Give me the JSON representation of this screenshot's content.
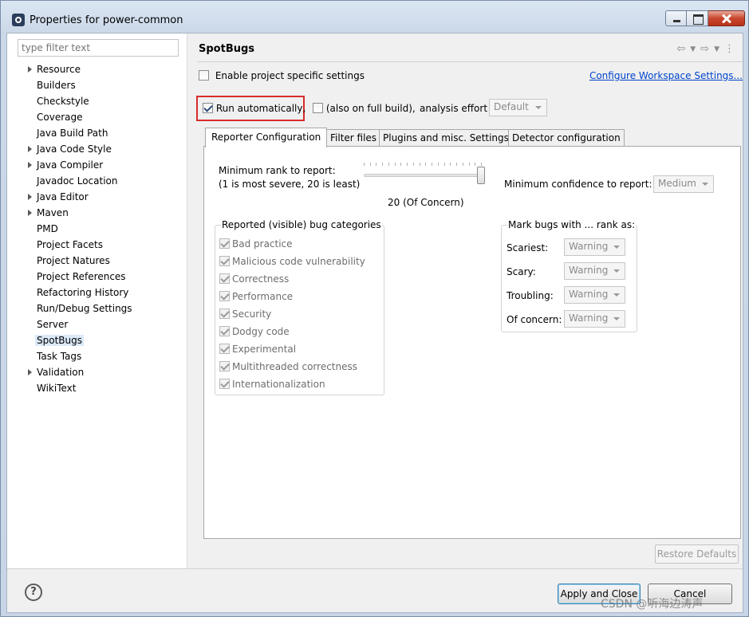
{
  "window": {
    "title": "Properties for power-common"
  },
  "filter": {
    "placeholder": "type filter text"
  },
  "tree": {
    "items": [
      {
        "label": "Resource",
        "expandable": true
      },
      {
        "label": "Builders",
        "expandable": false
      },
      {
        "label": "Checkstyle",
        "expandable": false
      },
      {
        "label": "Coverage",
        "expandable": false
      },
      {
        "label": "Java Build Path",
        "expandable": false
      },
      {
        "label": "Java Code Style",
        "expandable": true
      },
      {
        "label": "Java Compiler",
        "expandable": true
      },
      {
        "label": "Javadoc Location",
        "expandable": false
      },
      {
        "label": "Java Editor",
        "expandable": true
      },
      {
        "label": "Maven",
        "expandable": true
      },
      {
        "label": "PMD",
        "expandable": false
      },
      {
        "label": "Project Facets",
        "expandable": false
      },
      {
        "label": "Project Natures",
        "expandable": false
      },
      {
        "label": "Project References",
        "expandable": false
      },
      {
        "label": "Refactoring History",
        "expandable": false
      },
      {
        "label": "Run/Debug Settings",
        "expandable": false
      },
      {
        "label": "Server",
        "expandable": false
      },
      {
        "label": "SpotBugs",
        "expandable": false,
        "selected": true
      },
      {
        "label": "Task Tags",
        "expandable": false
      },
      {
        "label": "Validation",
        "expandable": true
      },
      {
        "label": "WikiText",
        "expandable": false
      }
    ]
  },
  "page": {
    "title": "SpotBugs",
    "enable_label": "Enable project specific settings",
    "configure_link": "Configure Workspace Settings...",
    "run_auto_label": "Run automatically,",
    "full_build_label": "(also on full build),",
    "effort_label": "analysis effort",
    "effort_value": "Default"
  },
  "tabs": [
    {
      "label": "Reporter Configuration",
      "active": true
    },
    {
      "label": "Filter files"
    },
    {
      "label": "Plugins and misc. Settings"
    },
    {
      "label": "Detector configuration"
    }
  ],
  "reporter": {
    "rank_label_1": "Minimum rank to report:",
    "rank_label_2": "(1 is most severe, 20 is least)",
    "rank_value": "20 (Of Concern)",
    "rank_fraction": 1.0,
    "confidence_label": "Minimum confidence to report:",
    "confidence_value": "Medium",
    "categories_title": "Reported (visible) bug categories",
    "categories": [
      "Bad practice",
      "Malicious code vulnerability",
      "Correctness",
      "Performance",
      "Security",
      "Dodgy code",
      "Experimental",
      "Multithreaded correctness",
      "Internationalization"
    ],
    "mark_title": "Mark bugs with ... rank as:",
    "mark_rows": [
      {
        "label": "Scariest:",
        "value": "Warning"
      },
      {
        "label": "Scary:",
        "value": "Warning"
      },
      {
        "label": "Troubling:",
        "value": "Warning"
      },
      {
        "label": "Of concern:",
        "value": "Warning"
      }
    ]
  },
  "buttons": {
    "restore": "Restore Defaults",
    "apply_close": "Apply and Close",
    "cancel": "Cancel"
  },
  "watermark": "CSDN @听海边涛声",
  "colors": {
    "highlight_box": "#d92b2b",
    "link": "#0044cc"
  }
}
